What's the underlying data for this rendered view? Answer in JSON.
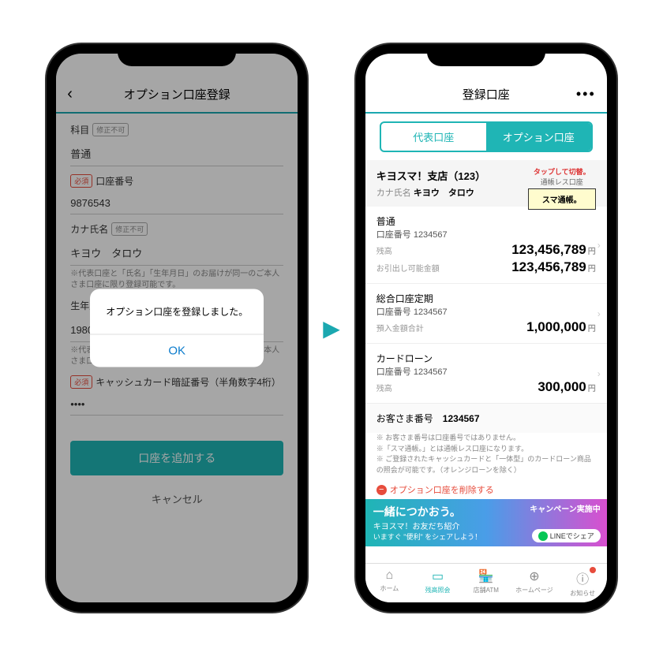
{
  "left": {
    "header_title": "オプション口座登録",
    "subject_label": "科目",
    "noedit_badge": "修正不可",
    "subject_value": "普通",
    "req_badge": "必須",
    "acctnum_label": "口座番号",
    "acctnum_value": "9876543",
    "kana_label": "カナ氏名",
    "kana_value": "キヨウ　タロウ",
    "kana_note": "※代表口座と「氏名」「生年月日」のお届けが同一のご本人さま口座に限り登録可能です。",
    "dob_label": "生年月日",
    "dob_value": "1980年5月5日",
    "dob_note": "※代表口座と「氏名」「生年月日」のお届けが同一のご本人さま口座に限り登録可能です。",
    "pin_label": "キャッシュカード暗証番号（半角数字4桁）",
    "pin_value": "••••",
    "btn_add": "口座を追加する",
    "btn_cancel": "キャンセル",
    "alert_msg": "オプション口座を登録しました。",
    "alert_ok": "OK"
  },
  "right": {
    "header_title": "登録口座",
    "tab_main": "代表口座",
    "tab_option": "オプション口座",
    "branch": "キヨスマ！支店（123）",
    "kana_label": "カナ氏名",
    "kana_value": "キヨウ　タロウ",
    "smart_tap": "タップして切替。",
    "smart_sub": "通帳レス口座",
    "smart_badge": "スマ通帳。",
    "items": [
      {
        "type": "普通",
        "num": "口座番号 1234567",
        "l1": "残高",
        "v1": "123,456,789",
        "l2": "お引出し可能金額",
        "v2": "123,456,789"
      },
      {
        "type": "総合口座定期",
        "num": "口座番号 1234567",
        "l1": "預入金額合計",
        "v1": "1,000,000"
      },
      {
        "type": "カードローン",
        "num": "口座番号 1234567",
        "l1": "残高",
        "v1": "300,000"
      }
    ],
    "cust_num_label": "お客さま番号",
    "cust_num_value": "1234567",
    "notes": "※ お客さま番号は口座番号ではありません。\n※「スマ通帳。」とは通帳レス口座になります。\n※ ご登録されたキャッシュカードと「一体型」のカードローン商品の照会が可能です。（オレンジローンを除く）",
    "delete_text": "オプション口座を削除する",
    "banner_big": "一緒につかおう。",
    "banner_sub": "キヨスマ！お友だち紹介",
    "banner_foot": "いますぐ \"便利\" をシェアしよう！",
    "banner_camp": "キャンペーン実施中",
    "banner_line": "LINEでシェア",
    "tabs": [
      "ホーム",
      "残高照会",
      "店舗ATM",
      "ホームページ",
      "お知らせ"
    ],
    "yen": "円"
  }
}
